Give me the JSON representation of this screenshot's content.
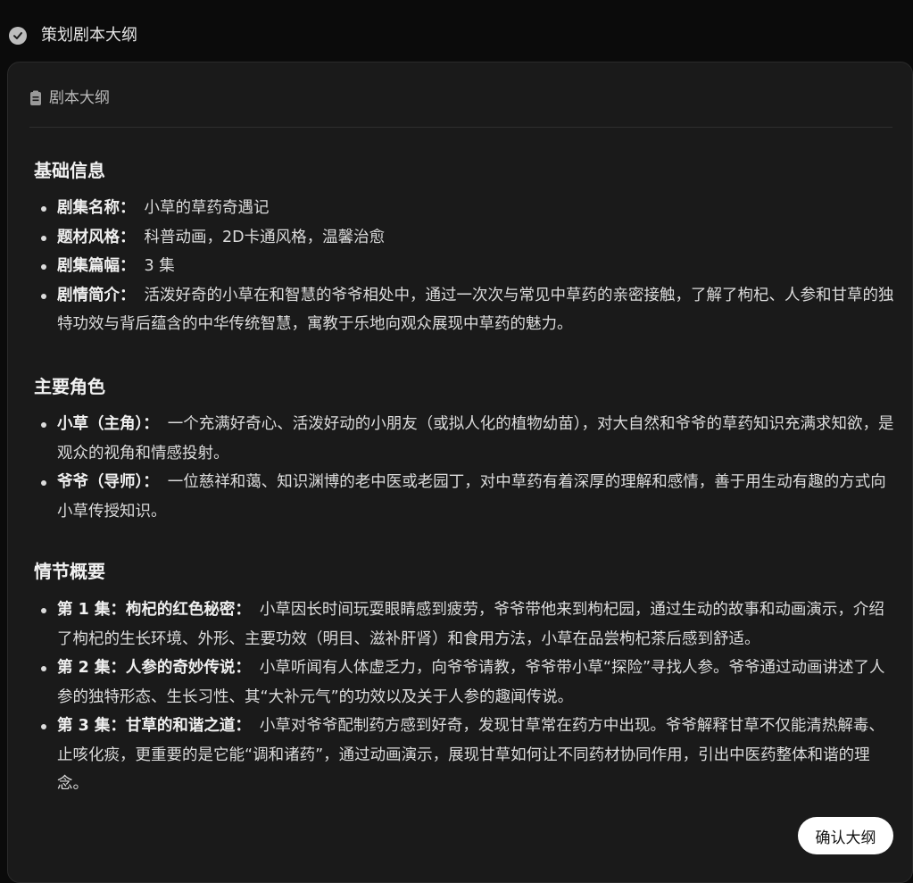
{
  "step": {
    "title": "策划剧本大纲",
    "status_icon": "check-circle-icon"
  },
  "card": {
    "header_title": "剧本大纲",
    "header_icon": "document-icon",
    "sections": [
      {
        "title": "基础信息",
        "items": [
          {
            "key": "剧集名称：",
            "value": "小草的草药奇遇记"
          },
          {
            "key": "题材风格：",
            "value": "科普动画，2D卡通风格，温馨治愈"
          },
          {
            "key": "剧集篇幅：",
            "value": "3 集"
          },
          {
            "key": "剧情简介：",
            "value": "活泼好奇的小草在和智慧的爷爷相处中，通过一次次与常见中草药的亲密接触，了解了枸杞、人参和甘草的独特功效与背后蕴含的中华传统智慧，寓教于乐地向观众展现中草药的魅力。"
          }
        ]
      },
      {
        "title": "主要角色",
        "items": [
          {
            "key": "小草（主角）：",
            "value": "一个充满好奇心、活泼好动的小朋友（或拟人化的植物幼苗），对大自然和爷爷的草药知识充满求知欲，是观众的视角和情感投射。"
          },
          {
            "key": "爷爷（导师）：",
            "value": "一位慈祥和蔼、知识渊博的老中医或老园丁，对中草药有着深厚的理解和感情，善于用生动有趣的方式向小草传授知识。"
          }
        ]
      },
      {
        "title": "情节概要",
        "items": [
          {
            "key": "第 1 集：枸杞的红色秘密：",
            "value": "小草因长时间玩耍眼睛感到疲劳，爷爷带他来到枸杞园，通过生动的故事和动画演示，介绍了枸杞的生长环境、外形、主要功效（明目、滋补肝肾）和食用方法，小草在品尝枸杞茶后感到舒适。"
          },
          {
            "key": "第 2 集：人参的奇妙传说：",
            "value": "小草听闻有人体虚乏力，向爷爷请教，爷爷带小草“探险”寻找人参。爷爷通过动画讲述了人参的独特形态、生长习性、其“大补元气”的功效以及关于人参的趣闻传说。"
          },
          {
            "key": "第 3 集：甘草的和谐之道：",
            "value": "小草对爷爷配制药方感到好奇，发现甘草常在药方中出现。爷爷解释甘草不仅能清热解毒、止咳化痰，更重要的是它能“调和诸药”，通过动画演示，展现甘草如何让不同药材协同作用，引出中医药整体和谐的理念。"
          }
        ]
      }
    ],
    "confirm_label": "确认大纲"
  }
}
